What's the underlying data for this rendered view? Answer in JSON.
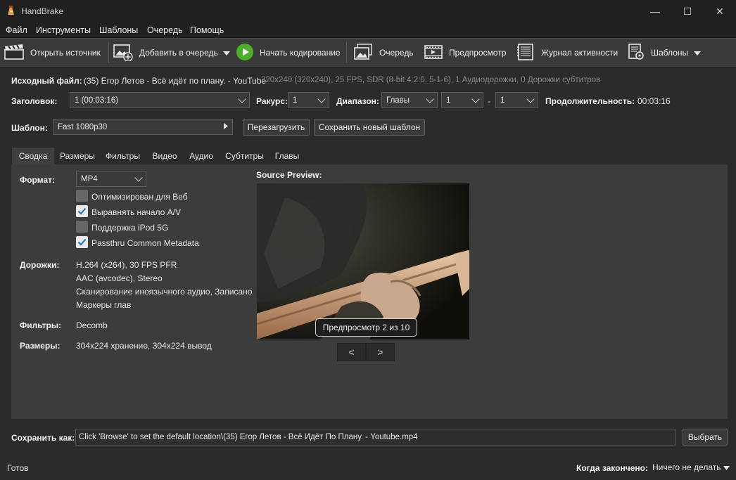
{
  "window": {
    "title": "HandBrake",
    "minimize": "—",
    "maximize": "☐",
    "close": "✕"
  },
  "menu": [
    "Файл",
    "Инструменты",
    "Шаблоны",
    "Очередь",
    "Помощь"
  ],
  "toolbar": {
    "open_source": "Открыть источник",
    "add_to_queue": "Добавить в очередь",
    "start_encode": "Начать кодирование",
    "queue": "Очередь",
    "preview": "Предпросмотр",
    "activity_log": "Журнал активности",
    "presets": "Шаблоны"
  },
  "source": {
    "label": "Исходный файл:",
    "name": "(35) Егор Летов - Всё идёт по плану. - YouTube",
    "info": "320x240 (320x240), 25 FPS, SDR (8-bit 4:2:0, 5-1-6), 1 Аудиодорожки, 0 Дорожки субтитров"
  },
  "title_row": {
    "title_label": "Заголовок:",
    "title_value": "1  (00:03:16)",
    "angle_label": "Ракурс:",
    "angle_value": "1",
    "range_label": "Диапазон:",
    "range_type": "Главы",
    "range_from": "1",
    "range_dash": "-",
    "range_to": "1",
    "duration_label": "Продолжительность:",
    "duration_value": "00:03:16"
  },
  "preset_row": {
    "label": "Шаблон:",
    "value": "Fast 1080p30",
    "reload": "Перезагрузить",
    "save_new": "Сохранить новый шаблон"
  },
  "tabs": [
    "Сводка",
    "Размеры",
    "Фильтры",
    "Видео",
    "Аудио",
    "Субтитры",
    "Главы"
  ],
  "summary": {
    "format_label": "Формат:",
    "format_value": "MP4",
    "options": [
      {
        "label": "Оптимизирован для Веб",
        "checked": false
      },
      {
        "label": "Выравнять начало A/V",
        "checked": true
      },
      {
        "label": "Поддержка iPod 5G",
        "checked": false
      },
      {
        "label": "Passthru Common Metadata",
        "checked": true
      }
    ],
    "tracks_label": "Дорожки:",
    "tracks": [
      "H.264 (x264), 30 FPS PFR",
      "AAC (avcodec), Stereo",
      "Сканирование иноязычного аудио, Записано",
      "Маркеры глав"
    ],
    "filters_label": "Фильтры:",
    "filters_value": "Decomb",
    "size_label": "Размеры:",
    "size_value": "304x224 хранение, 304x224 вывод"
  },
  "preview": {
    "header": "Source Preview:",
    "badge": "Предпросмотр 2 из 10",
    "prev": "<",
    "next": ">"
  },
  "save_as": {
    "label": "Сохранить как:",
    "value": "Click 'Browse' to set the default location\\(35) Егор Летов - Всё Идёт По Плану. - Youtube.mp4",
    "browse": "Выбрать"
  },
  "status": {
    "text": "Готов",
    "when_done_label": "Когда закончено:",
    "when_done_value": "Ничего не делать"
  },
  "colors": {
    "accent_check": "#1a73c8",
    "start_green": "#4caf2a"
  }
}
